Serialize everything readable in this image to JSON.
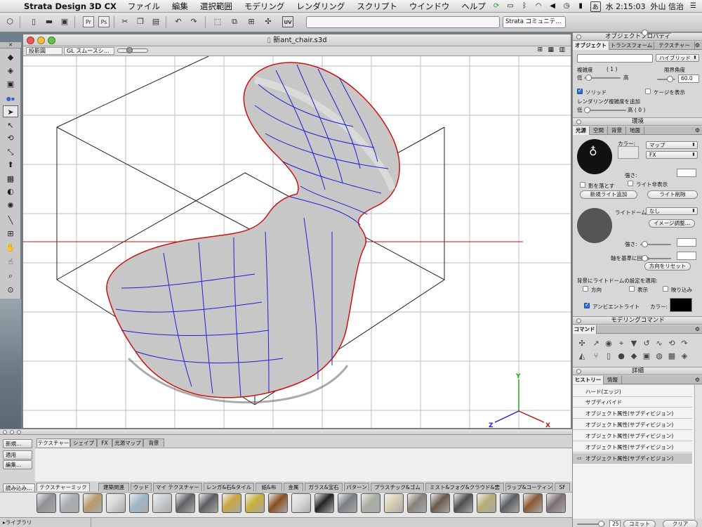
{
  "menubar": {
    "app_name": "Strata Design 3D CX",
    "menus": [
      "ファイル",
      "編集",
      "選択範囲",
      "モデリング",
      "レンダリング",
      "スクリプト",
      "ウインドウ",
      "ヘルプ"
    ],
    "status_icon_label": "あ",
    "clock": "水 2:15:03",
    "user": "外山 信治"
  },
  "toolbar": {
    "community_label": "Strata コミュニテ…"
  },
  "document": {
    "title": "新ant_chair.s3d",
    "view_mode": "投影図",
    "render_mode": "GL スムースシ…"
  },
  "object_props": {
    "title": "オブジェクトプロパティ",
    "tabs": [
      "オブジェクト",
      "トランスフォーム",
      "テクスチャー"
    ],
    "name_value": "",
    "type_value": "ハイブリッド",
    "complexity_label": "複雑度",
    "complexity_value": "( 1 )",
    "low": "低",
    "high": "高",
    "limit_angle_label": "限界角度",
    "limit_angle_value": "60.0",
    "solid_label": "ソリッド",
    "solid_checked": true,
    "cage_label": "ケージを表示",
    "cage_checked": false,
    "render_complexity_label": "レンダリング複雑度を追加",
    "render_low": "低",
    "render_high": "高 ( 0 )"
  },
  "environment": {
    "title": "環境",
    "tabs": [
      "光源",
      "空間",
      "背景",
      "地面"
    ],
    "color_label": "カラー:",
    "map_popup": "マップ",
    "fx_popup": "FX",
    "strength_label": "強さ:",
    "cast_shadow_label": "影を落とす",
    "light_hidden_label": "ライト非表示",
    "add_light_button": "新規ライト追加",
    "delete_light_button": "ライト削除",
    "light_dome_label": "ライトドーム:",
    "light_dome_value": "なし",
    "image_adjust_button": "イメージ調整…",
    "strength2_label": "強さ:",
    "rotate_label": "軸を基準に回転:",
    "reset_direction_button": "方向をリセット",
    "apply_bg_label": "背景にライトドームの設定を適用:",
    "direction_label": "方向",
    "display_label": "表示",
    "blur_label": "映り込み",
    "ambient_label": "アンビエントライト",
    "ambient_checked": true,
    "ambient_color_label": "カラー:"
  },
  "modeling": {
    "title": "モデリングコマンド",
    "tab": "コマンド"
  },
  "details": {
    "title": "詳細",
    "tabs": [
      "ヒストリー",
      "情報"
    ],
    "history": [
      "ハード(エッジ)",
      "サブディバイド",
      "オブジェクト属性(サブディビジョン)",
      "オブジェクト属性(サブディビジョン)",
      "オブジェクト属性(サブディビジョン)",
      "オブジェクト属性(サブディビジョン)",
      "オブジェクト属性(サブディビジョン)"
    ],
    "steps_value": "25",
    "commit_button": "コミット",
    "clear_button": "クリア"
  },
  "texture_palette": {
    "new_button": "新規…",
    "apply_button": "適用",
    "edit_button": "編集…",
    "top_tabs": [
      "テクスチャー",
      "シェイプ",
      "FX",
      "光源マップ",
      "背景"
    ],
    "load_button": "読み込み…",
    "lib_tabs": [
      "テクスチャーミックス",
      "建築関連",
      "ウッド",
      "マイ テクスチャー",
      "レンガ&石&タイル",
      "紙&布",
      "金属",
      "ガラス&宝石",
      "パターン",
      "プラスチック&ゴム",
      "ミスト&フォグ&クラウド&雲",
      "ラップ&コーティング",
      "SF"
    ],
    "library_label": "▸ライブラリ",
    "swatch_colors": [
      "#8d9196",
      "#a8aeb4",
      "#b89b6a",
      "#d8d8d8",
      "#9fb6c9",
      "#c9ced3",
      "#5f6266",
      "#5a5d60",
      "#c8a542",
      "#c9b03a",
      "#8b4e22",
      "#dcdcdc",
      "#222222",
      "#7b7f84",
      "#aab0a2",
      "#d9d0b4",
      "#88817a",
      "#6b5a4b",
      "#4e4e4e",
      "#b9ad76",
      "#5a5f64",
      "#8a5a33",
      "#7a6f74"
    ]
  },
  "axes": {
    "x": "X",
    "y": "Y",
    "z": "Z"
  },
  "colors": {
    "wire_blue": "#1f1fd6",
    "edge_red": "#cc1111",
    "mesh_gray": "#c4c4c4"
  }
}
